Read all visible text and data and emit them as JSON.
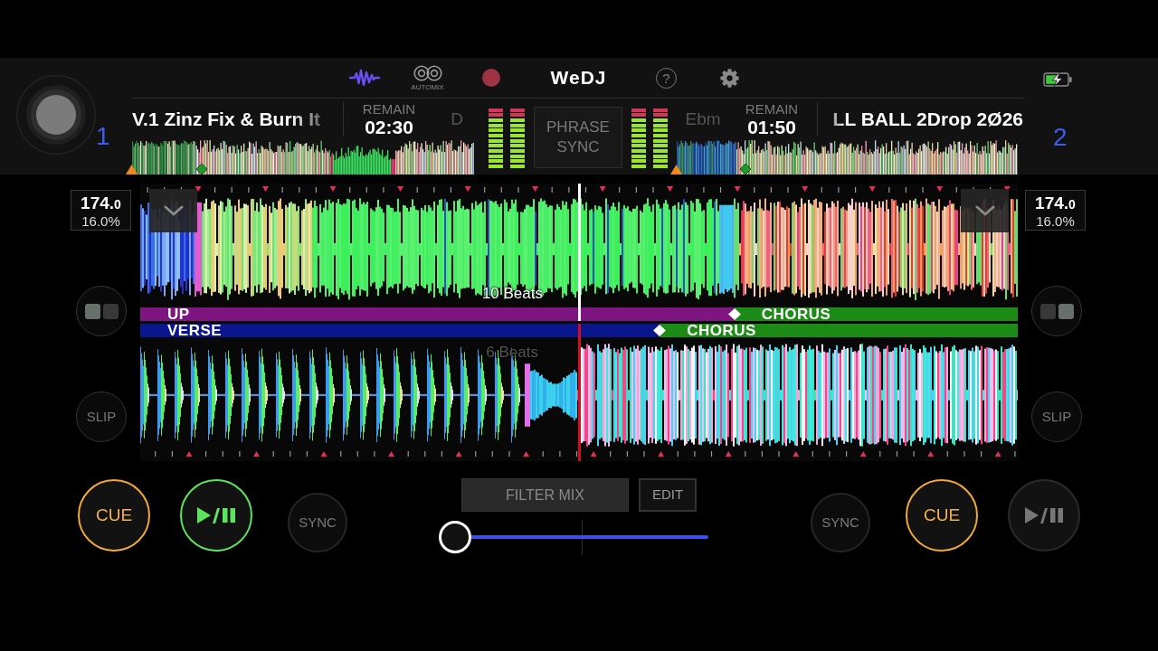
{
  "toolbar": {
    "waveform_view": {
      "selected": true
    },
    "automix": {
      "label": "AUTOMIX"
    },
    "record": {
      "on": false
    },
    "logo": "WeDJ",
    "help": "?"
  },
  "decks": [
    {
      "number": "1",
      "title": "V.1 Zinz Fix & Burn It",
      "remain_label": "REMAIN",
      "remain": "02:30",
      "key": "D",
      "meters": [
        {
          "level": 1
        },
        {
          "level": 1
        }
      ],
      "bpm": "174.0",
      "tempo": "16.0%",
      "beat_distance": "10 Beats",
      "phrases": [
        {
          "label": "UP",
          "color": "#7e1682"
        },
        {
          "label": "CHORUS",
          "color": "#1d8c17"
        }
      ],
      "mode_squares": [
        {
          "selected": true
        },
        {
          "selected": false
        }
      ],
      "slip": {
        "label": "SLIP",
        "on": false
      },
      "cue": {
        "label": "CUE",
        "on": true
      },
      "playing": true,
      "sync": {
        "label": "SYNC",
        "on": false
      }
    },
    {
      "number": "2",
      "title": "LL BALL 2Drop 2Ø26",
      "remain_label": "REMAIN",
      "remain": "01:50",
      "key": "Ebm",
      "meters": [
        {
          "level": 1
        },
        {
          "level": 1
        }
      ],
      "bpm": "174.0",
      "tempo": "16.0%",
      "beat_distance": "6 Beats",
      "phrases": [
        {
          "label": "VERSE",
          "color": "#0b168c"
        },
        {
          "label": "CHORUS",
          "color": "#1d8c17"
        }
      ],
      "mode_squares": [
        {
          "selected": false
        },
        {
          "selected": true
        }
      ],
      "slip": {
        "label": "SLIP",
        "on": false
      },
      "cue": {
        "label": "CUE",
        "on": true
      },
      "playing": false,
      "sync": {
        "label": "SYNC",
        "on": false
      }
    }
  ],
  "phrase_sync": {
    "label": "PHRASE SYNC",
    "on": false
  },
  "mixer": {
    "filter_mix": "FILTER MIX",
    "edit": "EDIT",
    "crossfader": {
      "level": 0
    }
  }
}
